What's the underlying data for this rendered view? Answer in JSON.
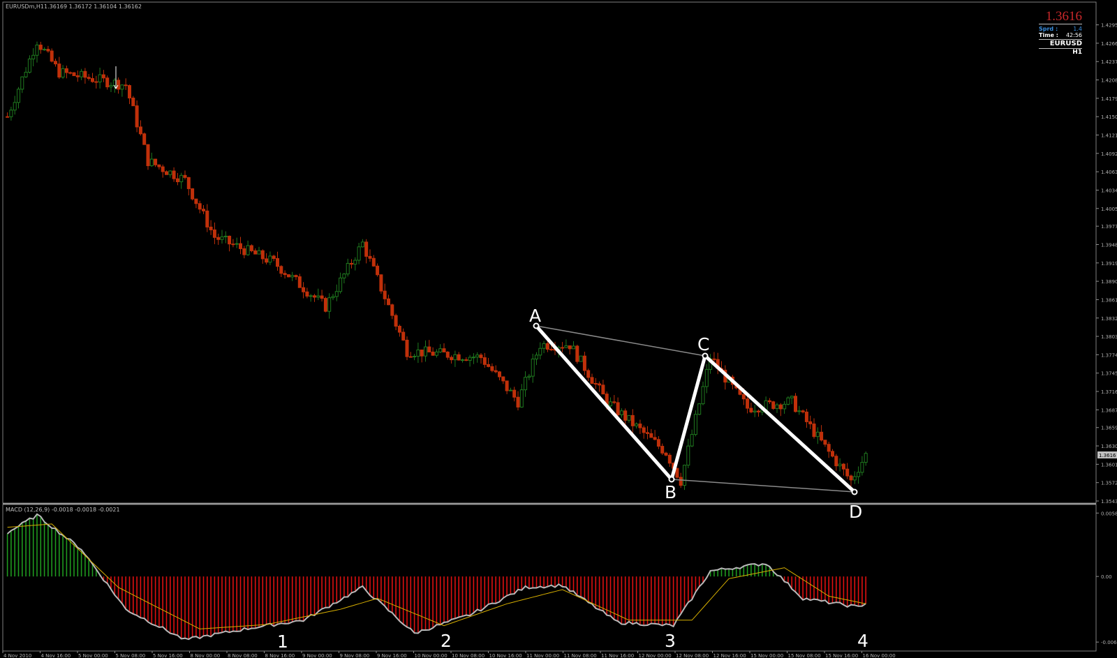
{
  "window": {
    "symbol_header": "EURUSDm,H1",
    "ohlc": "1.36169 1.36172 1.36104 1.36162"
  },
  "info_panel": {
    "price": "1.3616",
    "spread_label": "Sprd :",
    "spread_value": "1.4",
    "time_label": "Time :",
    "time_value": "42:56",
    "symbol": "EURUSD",
    "timeframe": "H1"
  },
  "price_axis": {
    "ticks": [
      "1.4295",
      "1.4266",
      "1.4237",
      "1.4208",
      "1.4179",
      "1.4150",
      "1.4121",
      "1.4092",
      "1.4063",
      "1.4034",
      "1.4005",
      "1.3977",
      "1.3948",
      "1.3919",
      "1.3890",
      "1.3861",
      "1.3832",
      "1.3803",
      "1.3774",
      "1.3745",
      "1.3716",
      "1.3687",
      "1.3659",
      "1.3630",
      "1.3601",
      "1.3572",
      "1.3543"
    ],
    "current_price_label": "1.3616"
  },
  "macd_axis": {
    "ticks": [
      "0.0058",
      "0.00",
      "-0.006"
    ]
  },
  "macd": {
    "label": "MACD (12,26,9) -0.0018 -0.0018 -0.0021"
  },
  "time_axis": {
    "ticks": [
      "4 Nov 2010",
      "4 Nov 16:00",
      "5 Nov 00:00",
      "5 Nov 08:00",
      "5 Nov 16:00",
      "8 Nov 00:00",
      "8 Nov 08:00",
      "8 Nov 16:00",
      "9 Nov 00:00",
      "9 Nov 08:00",
      "9 Nov 16:00",
      "10 Nov 00:00",
      "10 Nov 08:00",
      "10 Nov 16:00",
      "11 Nov 00:00",
      "11 Nov 08:00",
      "11 Nov 16:00",
      "12 Nov 00:00",
      "12 Nov 08:00",
      "12 Nov 16:00",
      "15 Nov 00:00",
      "15 Nov 08:00",
      "15 Nov 16:00",
      "16 Nov 00:00"
    ]
  },
  "pattern": {
    "points": [
      {
        "label": "A",
        "price": 1.3815
      },
      {
        "label": "B",
        "price": 1.3575
      },
      {
        "label": "C",
        "price": 1.377
      },
      {
        "label": "D",
        "price": 1.3557
      }
    ]
  },
  "divergence_labels": [
    "1",
    "2",
    "3",
    "4"
  ],
  "colors": {
    "bull": "#1f7a1f",
    "bear": "#c0300a",
    "macd_pos": "#1f9a1f",
    "macd_neg": "#e01010",
    "signal": "#d8b000",
    "macd_line": "#b8b8b8",
    "pattern": "#ffffff"
  },
  "chart_data": {
    "type": "candlestick+macd",
    "price_range": [
      1.3543,
      1.431
    ],
    "price_pivots": [
      [
        0,
        1.415
      ],
      [
        8,
        1.427
      ],
      [
        14,
        1.422
      ],
      [
        32,
        1.42
      ],
      [
        38,
        1.408
      ],
      [
        48,
        1.405
      ],
      [
        56,
        1.396
      ],
      [
        72,
        1.392
      ],
      [
        86,
        1.385
      ],
      [
        96,
        1.395
      ],
      [
        108,
        1.378
      ],
      [
        128,
        1.377
      ],
      [
        138,
        1.37
      ],
      [
        144,
        1.379
      ],
      [
        152,
        1.379
      ],
      [
        162,
        1.37
      ],
      [
        178,
        1.362
      ],
      [
        182,
        1.3575
      ],
      [
        190,
        1.377
      ],
      [
        200,
        1.369
      ],
      [
        212,
        1.37
      ],
      [
        222,
        1.362
      ],
      [
        228,
        1.3575
      ],
      [
        232,
        1.3616
      ]
    ],
    "macd_range": [
      -0.0065,
      0.0062
    ],
    "macd_pivots": [
      [
        0,
        0.004
      ],
      [
        8,
        0.0056
      ],
      [
        20,
        0.0025
      ],
      [
        32,
        -0.003
      ],
      [
        48,
        -0.0058
      ],
      [
        66,
        -0.0047
      ],
      [
        80,
        -0.004
      ],
      [
        96,
        -0.001
      ],
      [
        110,
        -0.0052
      ],
      [
        125,
        -0.0035
      ],
      [
        140,
        -0.001
      ],
      [
        150,
        -0.0008
      ],
      [
        165,
        -0.0042
      ],
      [
        180,
        -0.0045
      ],
      [
        190,
        0.0005
      ],
      [
        205,
        0.0012
      ],
      [
        215,
        -0.002
      ],
      [
        230,
        -0.0028
      ],
      [
        232,
        -0.0024
      ]
    ],
    "signal_pivots": [
      [
        0,
        0.0045
      ],
      [
        12,
        0.0048
      ],
      [
        30,
        -0.001
      ],
      [
        52,
        -0.0048
      ],
      [
        70,
        -0.0044
      ],
      [
        90,
        -0.003
      ],
      [
        100,
        -0.002
      ],
      [
        118,
        -0.0045
      ],
      [
        135,
        -0.0025
      ],
      [
        150,
        -0.0012
      ],
      [
        168,
        -0.004
      ],
      [
        185,
        -0.004
      ],
      [
        195,
        -0.0002
      ],
      [
        210,
        0.0008
      ],
      [
        222,
        -0.0018
      ],
      [
        232,
        -0.0025
      ]
    ]
  }
}
